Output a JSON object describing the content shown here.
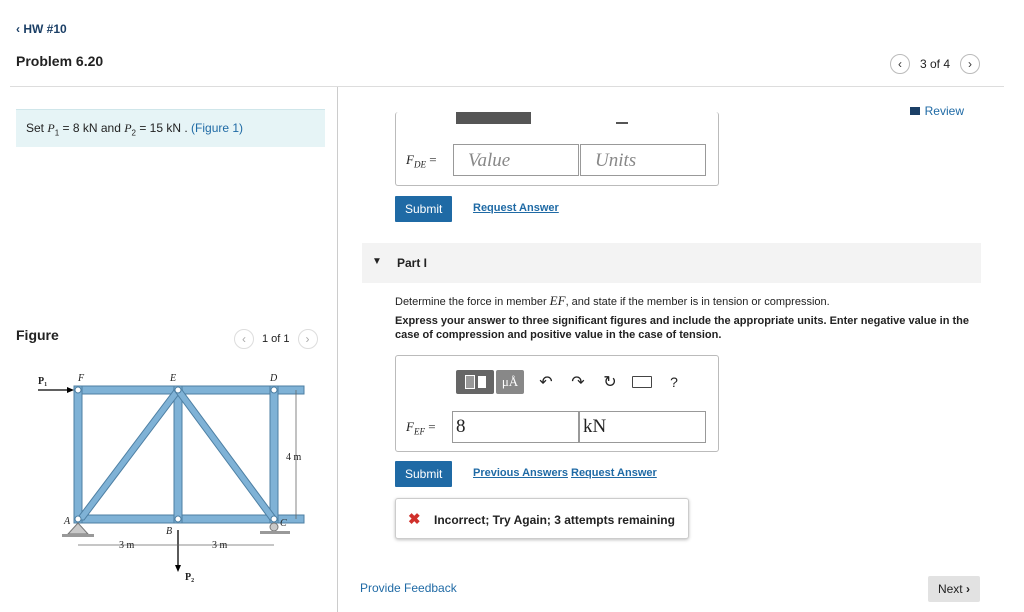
{
  "header": {
    "back_label": "HW #10",
    "problem_title": "Problem 6.20",
    "pager": {
      "current_text": "3 of 4"
    }
  },
  "left_panel": {
    "set_text_prefix": "Set ",
    "P1": "P",
    "P1_sub": "1",
    "eq1": " = 8  kN and ",
    "P2": "P",
    "P2_sub": "2",
    "eq2": " = 15  kN . ",
    "figure_link": "(Figure 1)",
    "figure_label": "Figure",
    "figure_pager": "1 of 1",
    "truss": {
      "labels": [
        "P",
        "F",
        "E",
        "D",
        "A",
        "B",
        "C",
        "3 m",
        "3 m",
        "4 m",
        "P"
      ],
      "sub_labels": [
        "1",
        "2"
      ]
    }
  },
  "review_label": "Review",
  "previous_part": {
    "label_var": "F",
    "label_sub": "DE",
    "label_eq": "=",
    "value_placeholder": "Value",
    "units_placeholder": "Units",
    "submit_label": "Submit",
    "request_answer_label": "Request Answer"
  },
  "part_i": {
    "title": "Part I",
    "prompt_prefix": "Determine the force in member ",
    "prompt_member": "EF",
    "prompt_suffix": ", and state if the member is in tension or compression.",
    "instructions": "Express your answer to three significant figures and include the appropriate units. Enter negative value in the case of compression and positive value in the case of tension.",
    "toolbar": {
      "mu_label": "μÅ",
      "help_label": "?"
    },
    "label_var": "F",
    "label_sub": "EF",
    "label_eq": "=",
    "value": "8",
    "units": "kN",
    "submit_label": "Submit",
    "previous_answers_label": "Previous Answers",
    "request_answer_label": "Request Answer",
    "feedback_text": "Incorrect; Try Again; 3 attempts remaining"
  },
  "footer": {
    "provide_feedback_label": "Provide Feedback",
    "next_label": "Next"
  },
  "colors": {
    "accent": "#1f6aa5",
    "truss": "#7fb2d6",
    "error": "#d0302b"
  }
}
